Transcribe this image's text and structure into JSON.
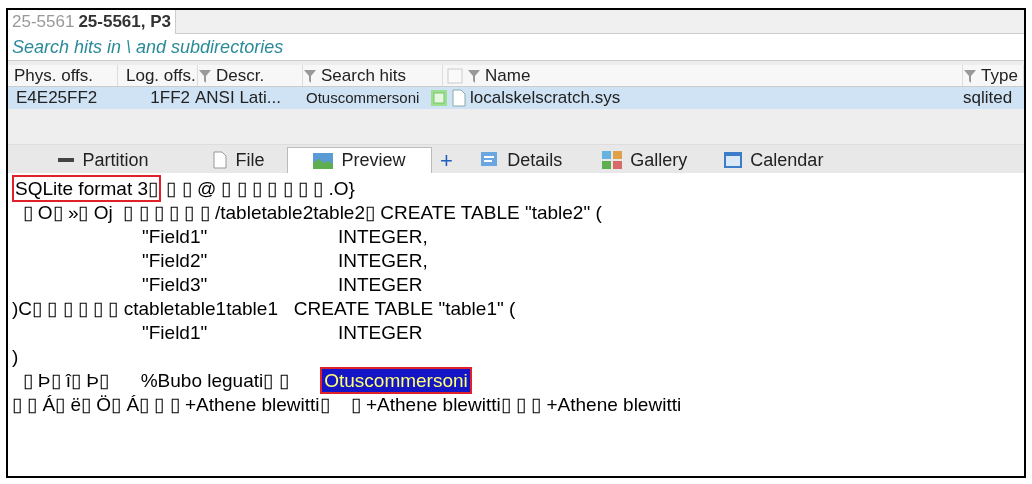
{
  "path_tabs": [
    {
      "label": "25-5561",
      "selected": false
    },
    {
      "label": "25-5561, P3",
      "selected": true
    }
  ],
  "scope": "Search hits in \\ and subdirectories",
  "table": {
    "columns": [
      {
        "label": "Phys. offs.",
        "filter": false
      },
      {
        "label": "Log. offs.",
        "filter": false
      },
      {
        "label": "Descr.",
        "filter": true
      },
      {
        "label": "Search hits",
        "filter": true
      },
      {
        "label": "Name",
        "filter": true
      },
      {
        "label": "Type",
        "filter": true
      }
    ],
    "rows": [
      {
        "selected": true,
        "cells": [
          "E4E25FF2",
          "1FF2",
          "ANSI Lati...",
          "Otuscommersoni",
          "localskelscratch.sys",
          "sqlited"
        ]
      }
    ]
  },
  "view_tabs": [
    {
      "kind": "tab",
      "label": "Partition",
      "selected": false
    },
    {
      "kind": "tab",
      "label": "File",
      "selected": false
    },
    {
      "kind": "tab",
      "label": "Preview",
      "selected": true
    },
    {
      "kind": "add",
      "label": "+",
      "selected": false
    },
    {
      "kind": "tab",
      "label": "Details",
      "selected": false
    },
    {
      "kind": "tab",
      "label": "Gallery",
      "selected": false
    },
    {
      "kind": "tab",
      "label": "Calendar",
      "selected": false
    }
  ],
  "preview_lines": [
    {
      "kind": "raw",
      "segments": [
        {
          "kind": "boxed",
          "text": "SQLite format 3▯"
        },
        {
          "kind": "text",
          "text": " ▯ ▯ @ ▯ ▯ ▯ ▯ ▯ ▯ ▯ .O}"
        }
      ]
    },
    {
      "kind": "raw",
      "segments": [
        {
          "kind": "text",
          "text": "  ▯ O▯ »▯ Oj  ▯ ▯ ▯ ▯ ▯ ▯ /tabletable2table2▯ CREATE TABLE \"table2\" ("
        }
      ]
    },
    {
      "kind": "field",
      "name": "\"Field1\"",
      "type": "INTEGER,"
    },
    {
      "kind": "field",
      "name": "\"Field2\"",
      "type": "INTEGER,"
    },
    {
      "kind": "field",
      "name": "\"Field3\"",
      "type": "INTEGER"
    },
    {
      "kind": "raw",
      "segments": [
        {
          "kind": "text",
          "text": ")C▯ ▯ ▯ ▯ ▯ ▯ ctabletable1table1   CREATE TABLE \"table1\" ("
        }
      ]
    },
    {
      "kind": "field",
      "name": "\"Field1\"",
      "type": "INTEGER"
    },
    {
      "kind": "raw",
      "segments": [
        {
          "kind": "text",
          "text": ")"
        }
      ]
    },
    {
      "kind": "raw",
      "segments": [
        {
          "kind": "text",
          "text": "  ▯ Þ▯ î▯ Þ▯      %Bubo leguati▯ ▯      "
        },
        {
          "kind": "hit",
          "text": "Otuscommersoni"
        }
      ]
    },
    {
      "kind": "raw",
      "segments": [
        {
          "kind": "text",
          "text": "▯ ▯ Á▯ ë▯ Ö▯ Á▯ ▯ ▯ +Athene blewitti▯    ▯ +Athene blewitti▯ ▯ ▯ +Athene blewitti"
        }
      ]
    }
  ]
}
